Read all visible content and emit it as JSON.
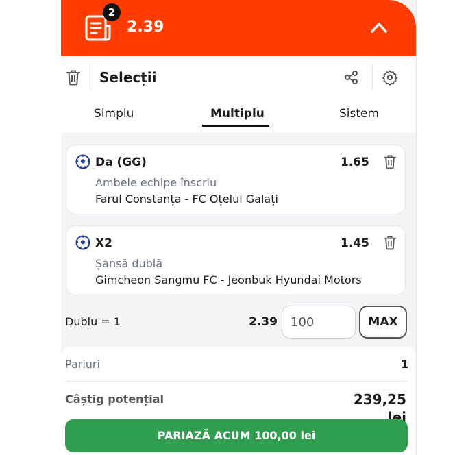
{
  "header": {
    "selection_count": "2",
    "total_odds": "2.39",
    "colors": {
      "accent": "#ff3d00"
    },
    "icons": {
      "slip": "betslip-icon",
      "collapse": "chevron-up-icon"
    }
  },
  "toolbar": {
    "title": "Selecții",
    "icons": {
      "clear": "trash-icon",
      "share": "share-icon",
      "settings": "gear-icon"
    }
  },
  "tabs": [
    {
      "label": "Simplu",
      "active": false
    },
    {
      "label": "Multiplu",
      "active": true
    },
    {
      "label": "Sistem",
      "active": false
    }
  ],
  "selections": [
    {
      "pick": "Da (GG)",
      "odds": "1.65",
      "market": "Ambele echipe înscriu",
      "event": "Farul Constanța - FC Oțelul Galați",
      "icon": "soccer-ball-icon"
    },
    {
      "pick": "X2",
      "odds": "1.45",
      "market": "Șansă dublă",
      "event": "Gimcheon Sangmu FC - Jeonbuk Hyundai Motors",
      "icon": "soccer-ball-icon"
    }
  ],
  "combination": {
    "label": "Dublu = 1",
    "odds": "2.39",
    "stake_value": "100",
    "max_label": "MAX"
  },
  "summary": {
    "bets_label": "Pariuri",
    "bets_count": "1",
    "potential_win_label": "Câștig potențial",
    "potential_win_value": "239,25 lei",
    "place_bet_label": "PARIAZĂ ACUM 100,00 lei",
    "colors": {
      "place_bet": "#2f9e4f"
    }
  }
}
